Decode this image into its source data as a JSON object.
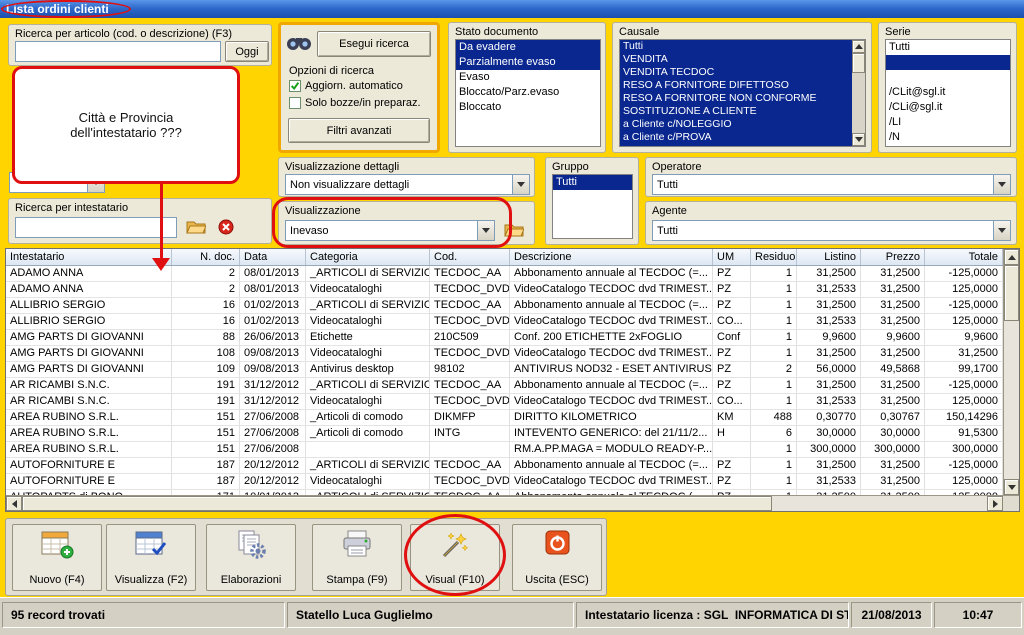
{
  "colors": {
    "bg_yellow": "#ffd400",
    "sel_navy": "#0a2790",
    "anno_red": "#e01010",
    "panel_gray": "#ece9d8",
    "titlebar_blue": "#2b66c8"
  },
  "window": {
    "title": "Lista ordini clienti"
  },
  "filters": {
    "ricerca_articolo": {
      "label": "Ricerca per articolo (cod. o descrizione) (F3)",
      "value": "",
      "oggi_button": "Oggi"
    },
    "hidden_combo_value": "",
    "ricerca_intestatario": {
      "label": "Ricerca per intestatario",
      "value": "",
      "folder_icon": "folder-icon",
      "clear_icon": "delete-icon"
    },
    "search_panel": {
      "search_icon": "binoculars-icon",
      "esegui_button": "Esegui ricerca",
      "opzioni_label": "Opzioni di ricerca",
      "checkboxes": [
        {
          "label": "Aggiorn. automatico",
          "checked": true
        },
        {
          "label": "Solo bozze/in preparaz.",
          "checked": false
        }
      ],
      "filtri_button": "Filtri avanzati"
    },
    "visualizzazione_dettagli": {
      "label": "Visualizzazione dettagli",
      "value": "Non visualizzare dettagli"
    },
    "visualizzazione": {
      "label": "Visualizzazione",
      "value": "Inevaso",
      "folder_icon": "folder-icon"
    },
    "stato_documento": {
      "label": "Stato documento",
      "items": [
        {
          "label": "Da evadere",
          "selected": true
        },
        {
          "label": "Parzialmente evaso",
          "selected": true
        },
        {
          "label": "Evaso",
          "selected": false
        },
        {
          "label": "Bloccato/Parz.evaso",
          "selected": false
        },
        {
          "label": "Bloccato",
          "selected": false
        }
      ]
    },
    "causale": {
      "label": "Causale",
      "items": [
        {
          "label": "Tutti",
          "selected": true
        },
        {
          "label": "VENDITA",
          "selected": true
        },
        {
          "label": "VENDITA TECDOC",
          "selected": true
        },
        {
          "label": "RESO A FORNITORE DIFETTOSO",
          "selected": true
        },
        {
          "label": "RESO A FORNITORE NON CONFORME",
          "selected": true
        },
        {
          "label": "SOSTITUZIONE A CLIENTE",
          "selected": true
        },
        {
          "label": "a Cliente c/NOLEGGIO",
          "selected": true
        },
        {
          "label": "a Cliente c/PROVA",
          "selected": true
        }
      ]
    },
    "serie": {
      "label": "Serie",
      "items": [
        {
          "label": "Tutti",
          "selected": false
        },
        {
          "label": "",
          "selected": true
        },
        {
          "label": "",
          "selected": false
        },
        {
          "label": "/CLit@sgl.it",
          "selected": false
        },
        {
          "label": "/CLi@sgl.it",
          "selected": false
        },
        {
          "label": "/LI",
          "selected": false
        },
        {
          "label": "/N",
          "selected": false
        }
      ]
    },
    "gruppo": {
      "label": "Gruppo",
      "items": [
        {
          "label": "Tutti",
          "selected": true
        }
      ]
    },
    "operatore": {
      "label": "Operatore",
      "value": "Tutti"
    },
    "agente": {
      "label": "Agente",
      "value": "Tutti"
    }
  },
  "table": {
    "columns": [
      "Intestatario",
      "N. doc.",
      "Data",
      "Categoria",
      "Cod.",
      "Descrizione",
      "UM",
      "Residuo",
      "Listino",
      "Prezzo",
      "Totale"
    ],
    "rows": [
      [
        "ADAMO ANNA",
        "2",
        "08/01/2013",
        "_ARTICOLI di SERVIZIO",
        "TECDOC_AA",
        "Abbonamento annuale al TECDOC (=...",
        "PZ",
        "1",
        "31,2500",
        "31,2500",
        "-125,0000"
      ],
      [
        "ADAMO ANNA",
        "2",
        "08/01/2013",
        "Videocataloghi",
        "TECDOC_DVD",
        "VideoCatalogo TECDOC dvd TRIMEST...",
        "PZ",
        "1",
        "31,2533",
        "31,2500",
        "125,0000"
      ],
      [
        "ALLIBRIO SERGIO",
        "16",
        "01/02/2013",
        "_ARTICOLI di SERVIZIO",
        "TECDOC_AA",
        "Abbonamento annuale al TECDOC (=...",
        "PZ",
        "1",
        "31,2500",
        "31,2500",
        "-125,0000"
      ],
      [
        "ALLIBRIO SERGIO",
        "16",
        "01/02/2013",
        "Videocataloghi",
        "TECDOC_DVD",
        "VideoCatalogo TECDOC dvd TRIMEST...",
        "CO...",
        "1",
        "31,2533",
        "31,2500",
        "125,0000"
      ],
      [
        "AMG PARTS DI GIOVANNI",
        "88",
        "26/06/2013",
        "Etichette",
        "210C509",
        "Conf. 200 ETICHETTE 2xFOGLIO",
        "Conf",
        "1",
        "9,9600",
        "9,9600",
        "9,9600"
      ],
      [
        "AMG PARTS DI GIOVANNI",
        "108",
        "09/08/2013",
        "Videocataloghi",
        "TECDOC_DVD",
        "VideoCatalogo TECDOC dvd TRIMEST...",
        "PZ",
        "1",
        "31,2500",
        "31,2500",
        "31,2500"
      ],
      [
        "AMG PARTS DI GIOVANNI",
        "109",
        "09/08/2013",
        "Antivirus desktop",
        "98102",
        "ANTIVIRUS NOD32 - ESET ANTIVIRUS...",
        "PZ",
        "2",
        "56,0000",
        "49,5868",
        "99,1700"
      ],
      [
        "AR RICAMBI S.N.C.",
        "191",
        "31/12/2012",
        "_ARTICOLI di SERVIZIO",
        "TECDOC_AA",
        "Abbonamento annuale al TECDOC (=...",
        "PZ",
        "1",
        "31,2500",
        "31,2500",
        "-125,0000"
      ],
      [
        "AR RICAMBI S.N.C.",
        "191",
        "31/12/2012",
        "Videocataloghi",
        "TECDOC_DVD",
        "VideoCatalogo TECDOC dvd TRIMEST...",
        "CO...",
        "1",
        "31,2533",
        "31,2500",
        "125,0000"
      ],
      [
        "AREA RUBINO S.R.L.",
        "151",
        "27/06/2008",
        "_Articoli di comodo",
        "DIKMFP",
        "DIRITTO KILOMETRICO",
        "KM",
        "488",
        "0,30770",
        "0,30767",
        "150,14296"
      ],
      [
        "AREA RUBINO S.R.L.",
        "151",
        "27/06/2008",
        "_Articoli di comodo",
        "INTG",
        "INTEVENTO GENERICO: del 21/11/2...",
        "H",
        "6",
        "30,0000",
        "30,0000",
        "91,5300"
      ],
      [
        "AREA RUBINO S.R.L.",
        "151",
        "27/06/2008",
        "",
        "",
        "RM.A.PP.MAGA = MODULO READY-P...",
        "",
        "1",
        "300,0000",
        "300,0000",
        "300,0000"
      ],
      [
        "AUTOFORNITURE E",
        "187",
        "20/12/2012",
        "_ARTICOLI di SERVIZIO",
        "TECDOC_AA",
        "Abbonamento annuale al TECDOC (=...",
        "PZ",
        "1",
        "31,2500",
        "31,2500",
        "-125,0000"
      ],
      [
        "AUTOFORNITURE E",
        "187",
        "20/12/2012",
        "Videocataloghi",
        "TECDOC_DVD",
        "VideoCatalogo TECDOC dvd TRIMEST...",
        "PZ",
        "1",
        "31,2533",
        "31,2500",
        "125,0000"
      ],
      [
        "AUTOPARTS di BONO",
        "171",
        "10/01/2013",
        "_ARTICOLI di SERVIZIO",
        "TECDOC_AA",
        "Abbonamento annuale al TECDOC (...",
        "PZ",
        "1",
        "31,2500",
        "31,2500",
        "125,0000"
      ]
    ]
  },
  "toolbar": {
    "buttons": [
      {
        "label": "Nuovo (F4)",
        "icon": "table-plus-icon"
      },
      {
        "label": "Visualizza (F2)",
        "icon": "table-check-icon"
      },
      {
        "label": "Elaborazioni",
        "icon": "documents-gear-icon"
      },
      {
        "label": "Stampa (F9)",
        "icon": "printer-icon"
      },
      {
        "label": "Visual (F10)",
        "icon": "magic-wand-icon"
      },
      {
        "label": "Uscita (ESC)",
        "icon": "power-icon"
      }
    ]
  },
  "status_bar": {
    "records": "95 record trovati",
    "user": "Statello Luca Guglielmo",
    "license": "Intestatario licenza : SGL  INFORMATICA DI STAT",
    "date": "21/08/2013",
    "time": "10:47"
  },
  "annotations": {
    "note_text": "Città e Provincia dell'intestatario ???"
  }
}
